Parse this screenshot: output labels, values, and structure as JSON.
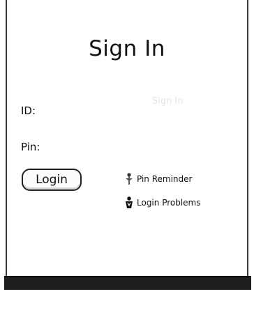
{
  "signin": {
    "title": "Sign In",
    "faint_header": "Sign In",
    "id_label": "ID:",
    "pin_label": "Pin:",
    "login_button": "Login",
    "pin_reminder_link": "Pin Reminder",
    "login_problems_link": "Login Problems"
  },
  "icons": {
    "pin_reminder": "pin-icon",
    "login_problems": "person-help-icon"
  }
}
